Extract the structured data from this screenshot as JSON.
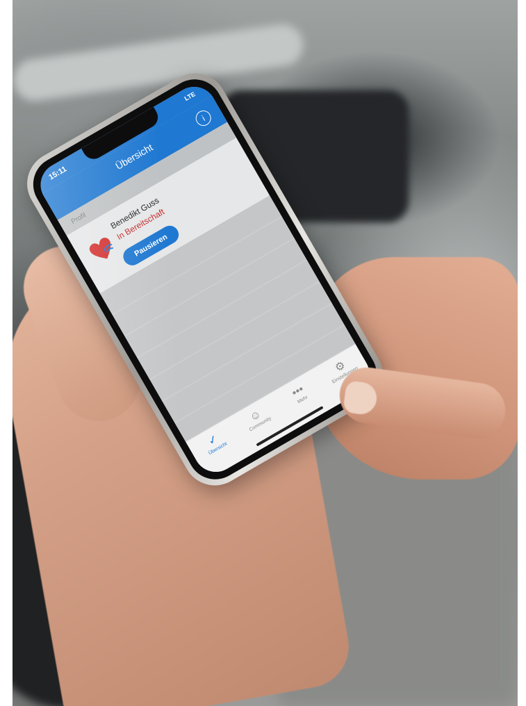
{
  "status_bar": {
    "time": "15:11",
    "signal_text": "LTE"
  },
  "nav": {
    "title": "Übersicht",
    "info_icon": "info-icon"
  },
  "section": {
    "label": "Profil"
  },
  "profile": {
    "name": "Benedikt Guss",
    "status": "In Bereitschaft",
    "pause_label": "Pausieren",
    "logo_icon": "heart-logo-icon"
  },
  "tabs": [
    {
      "label": "Übersicht",
      "icon": "checkmark-icon",
      "active": true
    },
    {
      "label": "Community",
      "icon": "person-icon",
      "active": false
    },
    {
      "label": "Mehr",
      "icon": "more-icon",
      "active": false
    },
    {
      "label": "Einstellungen",
      "icon": "gear-icon",
      "active": false
    }
  ],
  "colors": {
    "accent": "#1f78d1",
    "status_red": "#c62828"
  }
}
